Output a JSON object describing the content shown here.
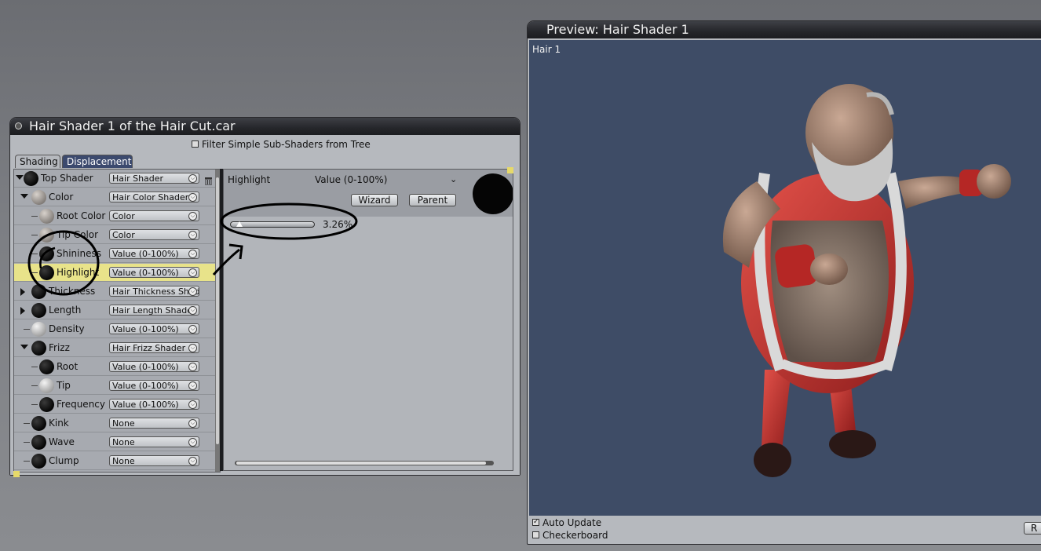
{
  "shader_window": {
    "title": "Hair Shader 1 of the Hair Cut.car",
    "filter_label": "Filter Simple Sub-Shaders from Tree",
    "tabs": [
      {
        "label": "Shading"
      },
      {
        "label": "Displacement"
      }
    ],
    "tree": [
      {
        "label": "Top Shader",
        "value": "Hair Shader",
        "ball": "dark",
        "twist": "down"
      },
      {
        "label": "Color",
        "value": "Hair Color Shader",
        "ball": "mid",
        "twist": "down"
      },
      {
        "label": "Root Color",
        "value": "Color",
        "ball": "mid"
      },
      {
        "label": "Tip Color",
        "value": "Color",
        "ball": "mid"
      },
      {
        "label": "Shininess",
        "value": "Value (0-100%)",
        "ball": "dark"
      },
      {
        "label": "Highlight",
        "value": "Value (0-100%)",
        "ball": "dark",
        "selected": true
      },
      {
        "label": "Thickness",
        "value": "Hair Thickness Shade",
        "ball": "dark",
        "twist": "right"
      },
      {
        "label": "Length",
        "value": "Hair Length Shader",
        "ball": "dark",
        "twist": "right"
      },
      {
        "label": "Density",
        "value": "Value (0-100%)",
        "ball": "light"
      },
      {
        "label": "Frizz",
        "value": "Hair Frizz Shader",
        "ball": "dark",
        "twist": "down"
      },
      {
        "label": "Root",
        "value": "Value (0-100%)",
        "ball": "dark"
      },
      {
        "label": "Tip",
        "value": "Value (0-100%)",
        "ball": "light"
      },
      {
        "label": "Frequency",
        "value": "Value (0-100%)",
        "ball": "dark"
      },
      {
        "label": "Kink",
        "value": "None",
        "ball": "dark"
      },
      {
        "label": "Wave",
        "value": "None",
        "ball": "dark"
      },
      {
        "label": "Clump",
        "value": "None",
        "ball": "dark"
      }
    ],
    "detail": {
      "name": "Highlight",
      "type": "Value (0-100%)",
      "wizard_label": "Wizard",
      "parent_label": "Parent",
      "slider_value": 0.0326,
      "percent_text": "3.26%"
    }
  },
  "preview_window": {
    "title": "Preview: Hair Shader 1",
    "viewport_label": "Hair 1",
    "auto_update_label": "Auto Update",
    "auto_update_checked": true,
    "checkerboard_label": "Checkerboard",
    "checkerboard_checked": false,
    "right_button_label": "R"
  },
  "colors": {
    "title_bar": "#25262a",
    "selected_row": "#e8e38a",
    "viewport_bg": "#3e4c66",
    "suit_red": "#c8312e"
  }
}
